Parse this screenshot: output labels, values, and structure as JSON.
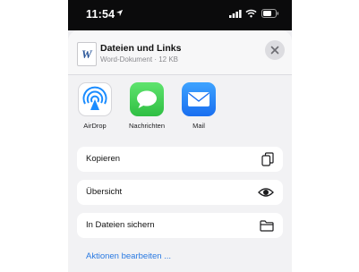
{
  "status_bar": {
    "time": "11:54",
    "icons": [
      "location-arrow-icon",
      "signal-icon",
      "wifi-icon",
      "battery-icon"
    ]
  },
  "share_sheet": {
    "file": {
      "icon": "word-document-icon",
      "icon_letter": "W",
      "title": "Dateien und Links",
      "subtitle": "Word-Dokument · 12 KB"
    },
    "apps": [
      {
        "label": "AirDrop",
        "icon": "airdrop-icon"
      },
      {
        "label": "Nachrichten",
        "icon": "messages-icon"
      },
      {
        "label": "Mail",
        "icon": "mail-icon"
      }
    ],
    "actions": [
      {
        "label": "Kopieren",
        "icon": "copy-icon"
      },
      {
        "label": "Übersicht",
        "icon": "eye-icon"
      },
      {
        "label": "In Dateien sichern",
        "icon": "folder-icon"
      }
    ],
    "edit_actions_label": "Aktionen bearbeiten ..."
  },
  "colors": {
    "link": "#2a7ae2",
    "word_blue": "#2b579a",
    "messages_green": "#34c759",
    "mail_blue": "#1a6ff0",
    "airdrop_blue": "#1a8cff"
  }
}
